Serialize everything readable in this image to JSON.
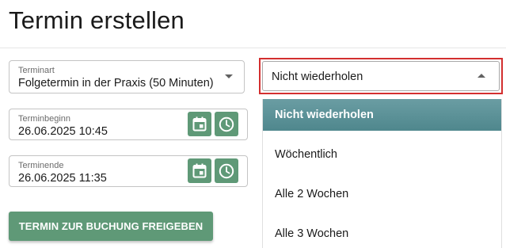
{
  "page": {
    "title": "Termin erstellen"
  },
  "form": {
    "type_field": {
      "label": "Terminart",
      "value": "Folgetermin in der Praxis (50 Minuten)"
    },
    "begin_field": {
      "label": "Terminbeginn",
      "value": "26.06.2025 10:45"
    },
    "end_field": {
      "label": "Terminende",
      "value": "26.06.2025 11:35"
    },
    "release_button": "TERMIN ZUR BUCHUNG FREIGEBEN"
  },
  "repeat": {
    "selected": "Nicht wiederholen",
    "options": [
      "Nicht wiederholen",
      "Wöchentlich",
      "Alle 2 Wochen",
      "Alle 3 Wochen"
    ]
  },
  "colors": {
    "accent_green": "#5f9977",
    "selected_option": "#5b9297",
    "highlight_red": "#d32f2f"
  },
  "icons": {
    "calendar": "calendar-icon",
    "clock": "clock-icon",
    "dropdown_closed": "triangle-down-icon",
    "dropdown_open": "triangle-up-icon"
  }
}
